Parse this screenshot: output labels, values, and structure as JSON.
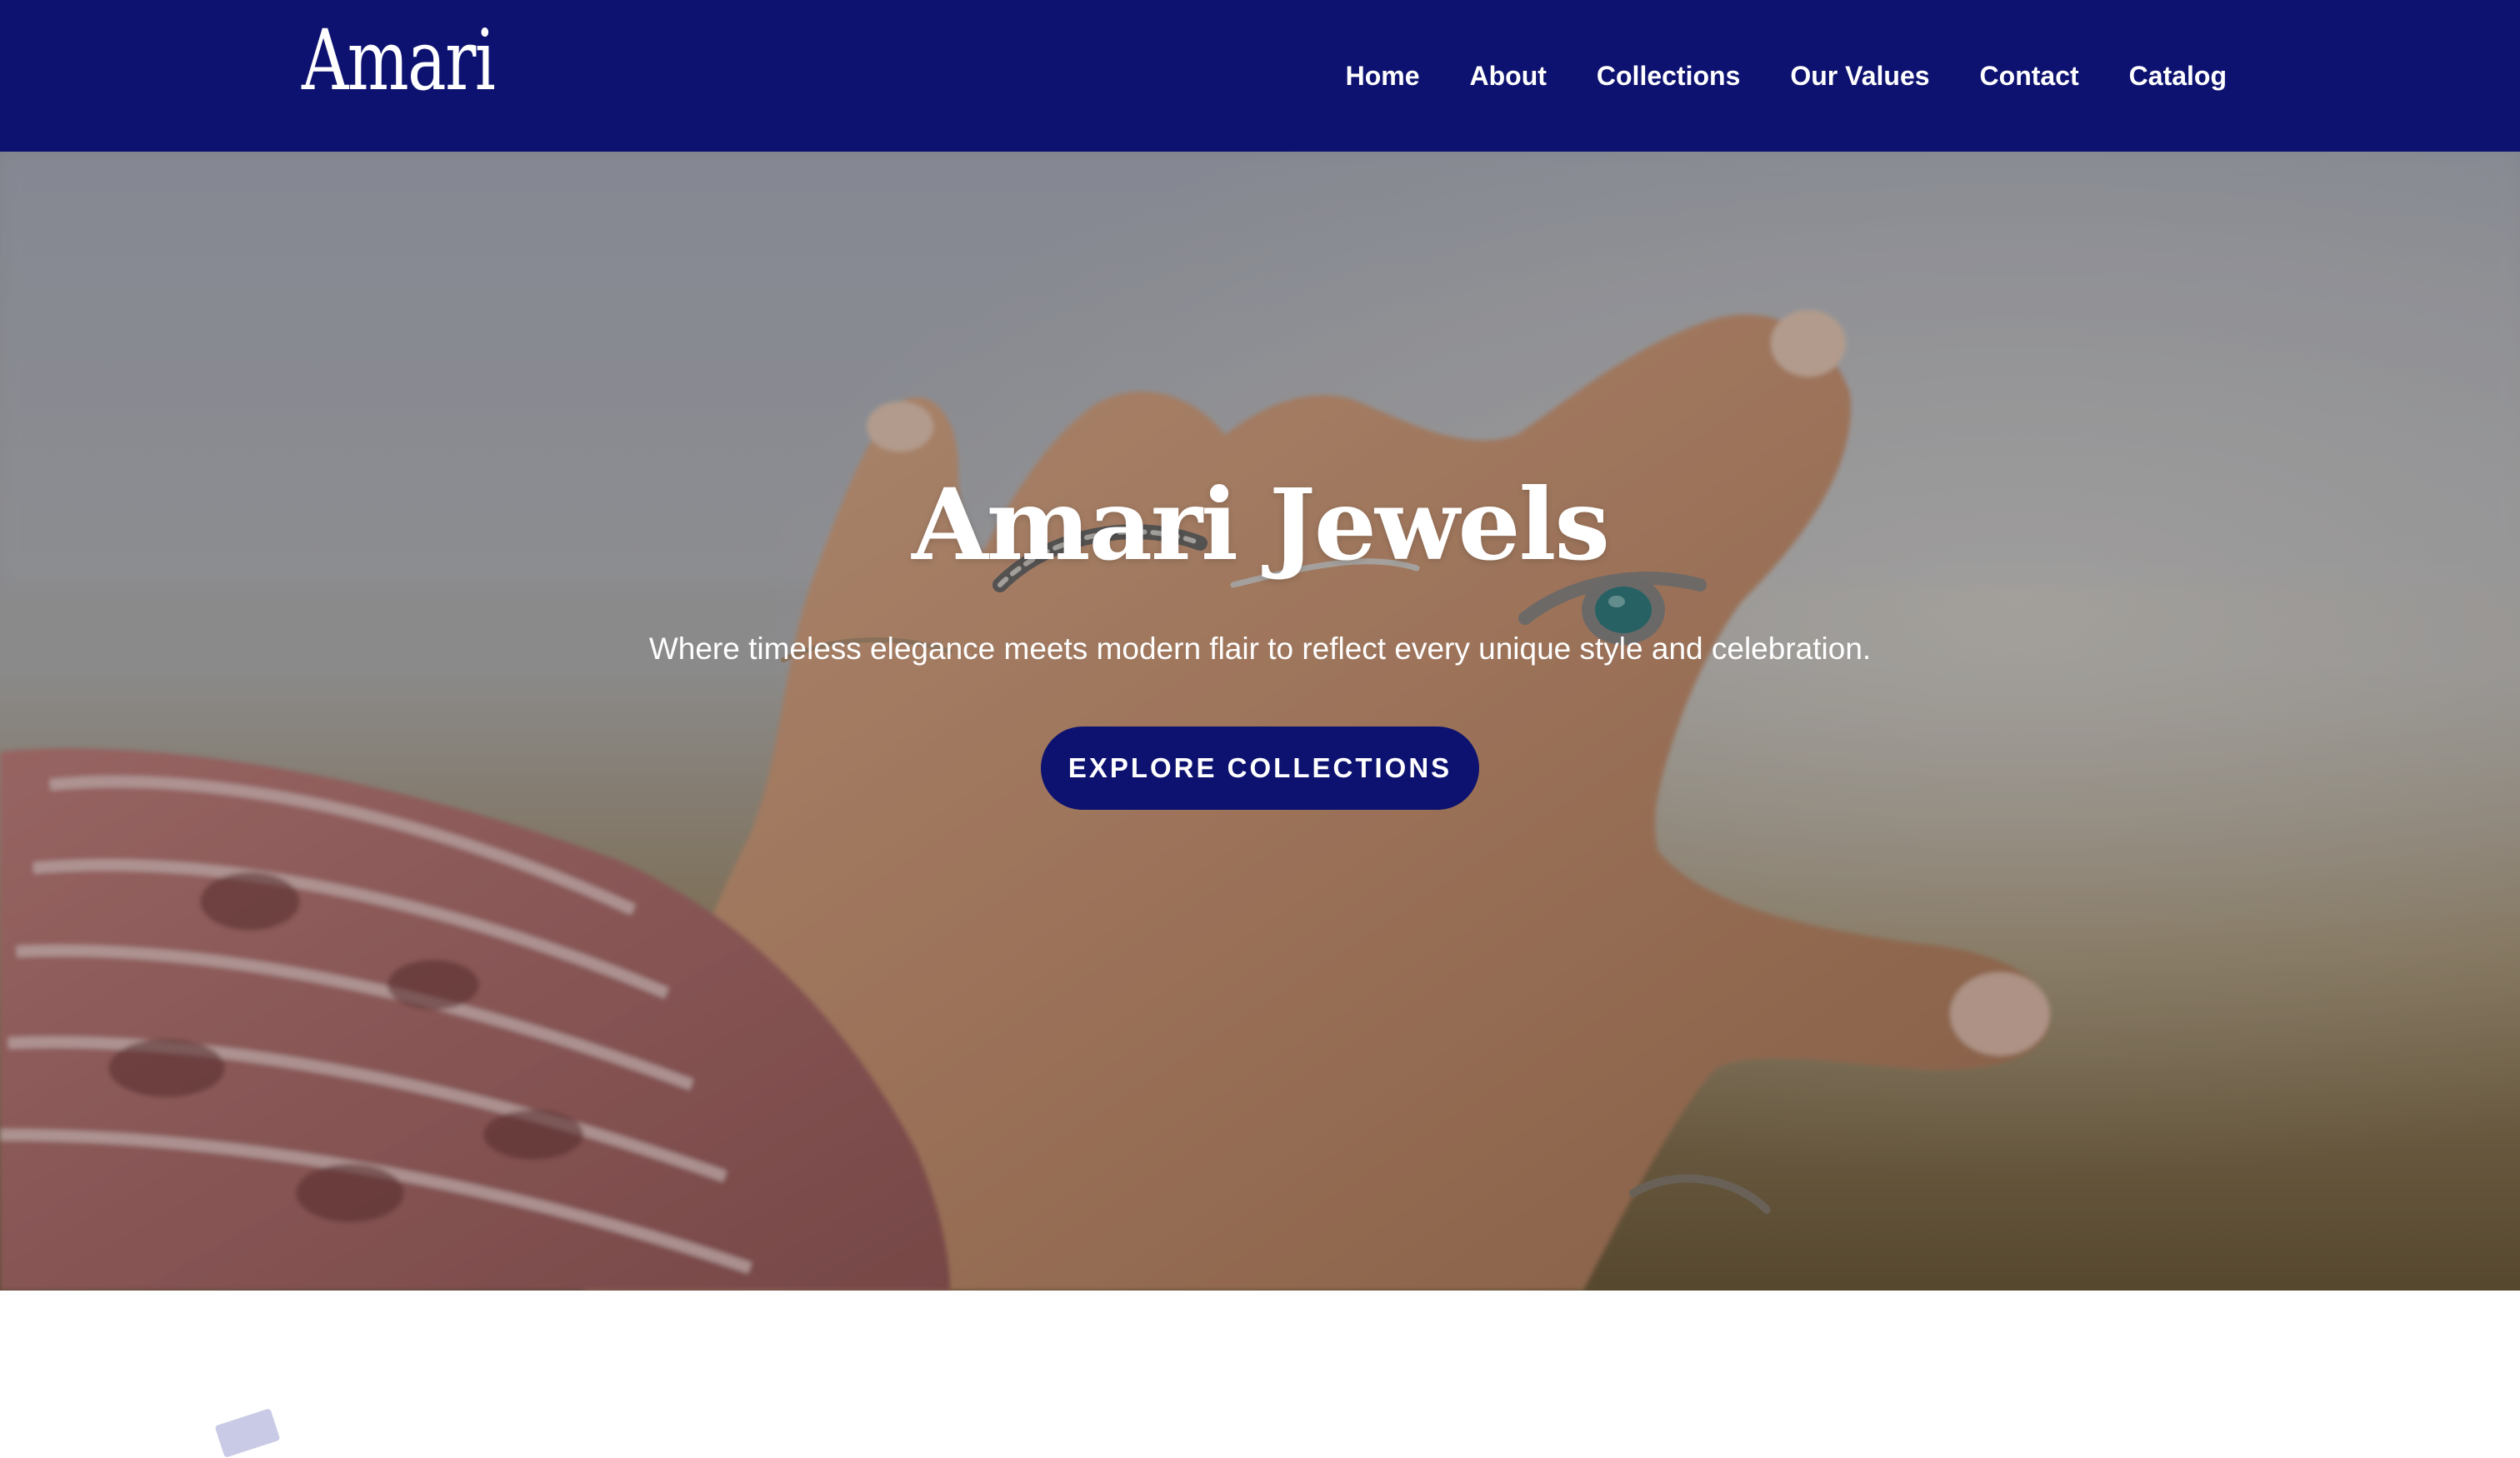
{
  "header": {
    "logo_text": "Amari",
    "nav": [
      {
        "label": "Home"
      },
      {
        "label": "About"
      },
      {
        "label": "Collections"
      },
      {
        "label": "Our Values"
      },
      {
        "label": "Contact"
      },
      {
        "label": "Catalog"
      }
    ]
  },
  "hero": {
    "title": "Amari Jewels",
    "subtitle": "Where timeless elegance meets modern flair to reflect every unique style and celebration.",
    "cta_label": "EXPLORE COLLECTIONS",
    "image_semantic": "hand-with-rings-photo"
  },
  "colors": {
    "brand_navy": "#0d1270",
    "text_light": "#ffffff"
  }
}
